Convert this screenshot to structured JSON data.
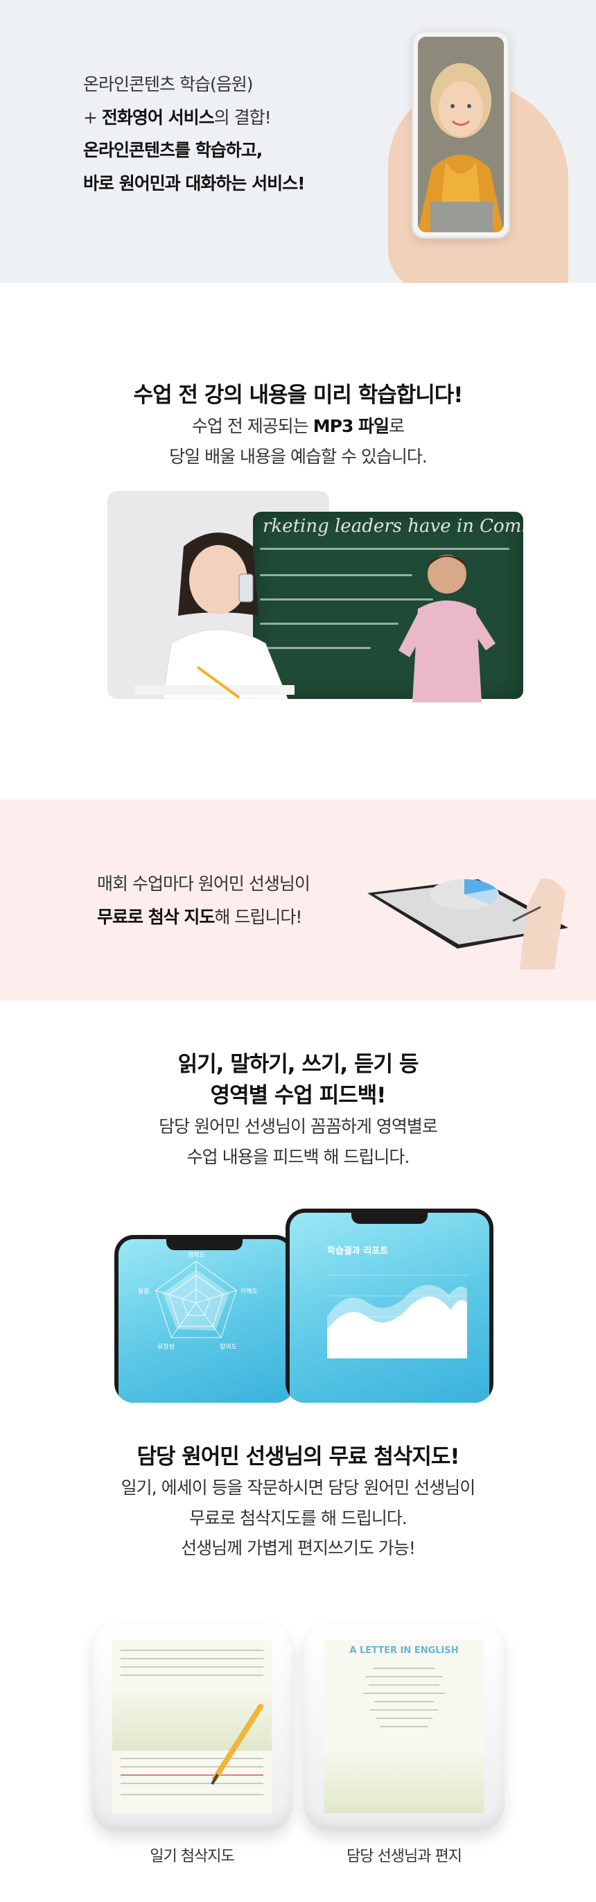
{
  "intro": {
    "line1": "온라인콘텐츠 학습(음원)",
    "line2_prefix": "+ ",
    "line2_bold": "전화영어 서비스",
    "line2_suffix": "의 결합!",
    "line3": "온라인콘텐츠를 학습하고,",
    "line4": "바로 원어민과 대화하는 서비스!"
  },
  "preview": {
    "title": "수업 전 강의 내용을 미리 학습합니다!",
    "line1_prefix": "수업 전 제공되는 ",
    "line1_bold": "MP3 파일",
    "line1_suffix": "로",
    "line2": "당일 배울 내용을 예습할 수 있습니다.",
    "board_text": "rketing leaders have in Commo"
  },
  "correction_banner": {
    "line1": "매회 수업마다 원어민 선생님이",
    "line2_bold": "무료로 첨삭 지도",
    "line2_suffix": "해 드립니다!"
  },
  "feedback": {
    "title1": "읽기, 말하기, 쓰기, 듣기 등",
    "title2": "영역별 수업 피드백!",
    "line1": "담당 원어민 선생님이 꼼꼼하게 영역별로",
    "line2": "수업 내용을 피드백 해 드립니다.",
    "radar_labels": [
      "정확도",
      "이해도",
      "참여도",
      "유창성",
      "발음"
    ],
    "report_title": "학습결과 리포트",
    "colors": {
      "screen_top": "#9ae8f5",
      "screen_bottom": "#3ab2dc"
    }
  },
  "writing": {
    "title": "담당 원어민 선생님의 무료 첨삭지도!",
    "line1": "일기, 에세이 등을 작문하시면 담당 원어민 선생님이",
    "line2": "무료로 첨삭지도를 해 드립니다.",
    "line3": "선생님께 가볍게 편지쓰기도 가능!",
    "letter_title": "A LETTER IN ENGLISH",
    "cards": [
      {
        "caption": "일기 첨삭지도"
      },
      {
        "caption": "담당 선생님과 편지"
      }
    ]
  }
}
